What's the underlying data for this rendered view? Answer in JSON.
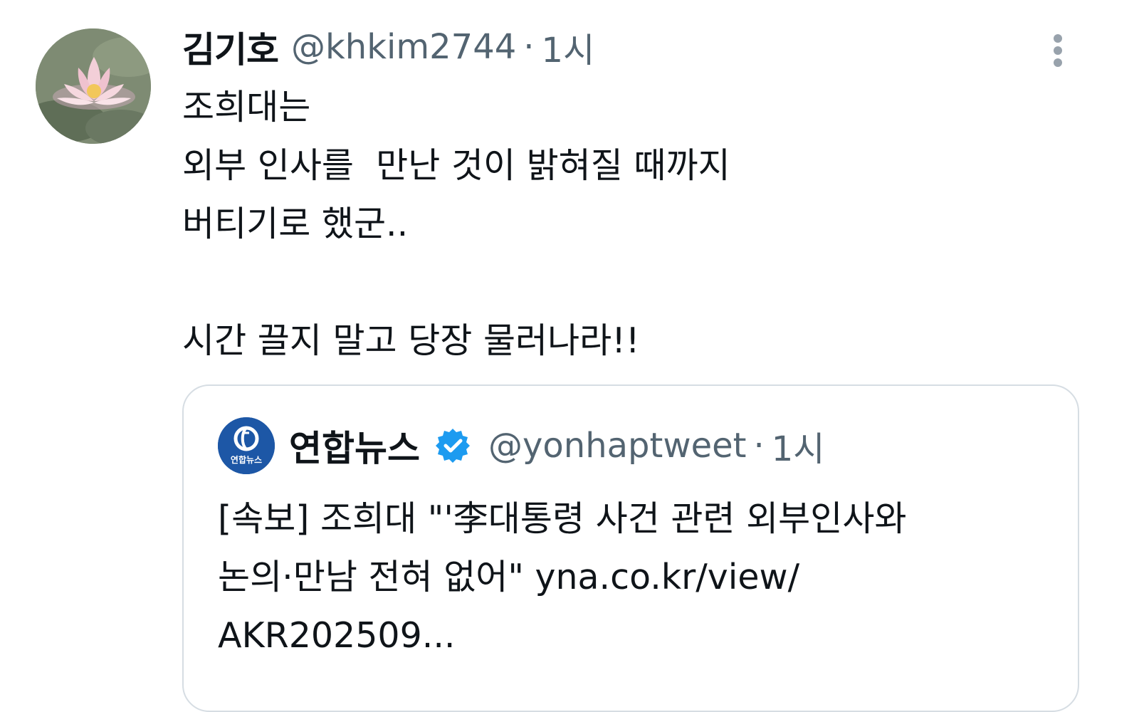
{
  "tweet": {
    "display_name": "김기호",
    "handle": "@khkim2744",
    "separator": "·",
    "time": "1시",
    "body_lines": [
      "조희대는",
      "외부 인사를  만난 것이 밝혀질 때까지",
      "버티기로 했군..",
      "",
      "시간 끌지 말고 당장 물러나라!!"
    ],
    "avatar_icon": "water-lily-avatar",
    "more_icon": "more-vertical-icon"
  },
  "quoted_tweet": {
    "display_name": "연합뉴스",
    "verified_icon": "verified-badge-icon",
    "verified_color": "#1d9bf0",
    "handle": "@yonhaptweet",
    "separator": "·",
    "time": "1시",
    "body_lines": [
      "[속보] 조희대 \"'李대통령 사건 관련 외부인사와",
      "논의·만남 전혀 없어\" yna.co.kr/view/",
      "AKR202509..."
    ],
    "avatar_label": "연합뉴스",
    "avatar_color": "#1d57a6"
  }
}
